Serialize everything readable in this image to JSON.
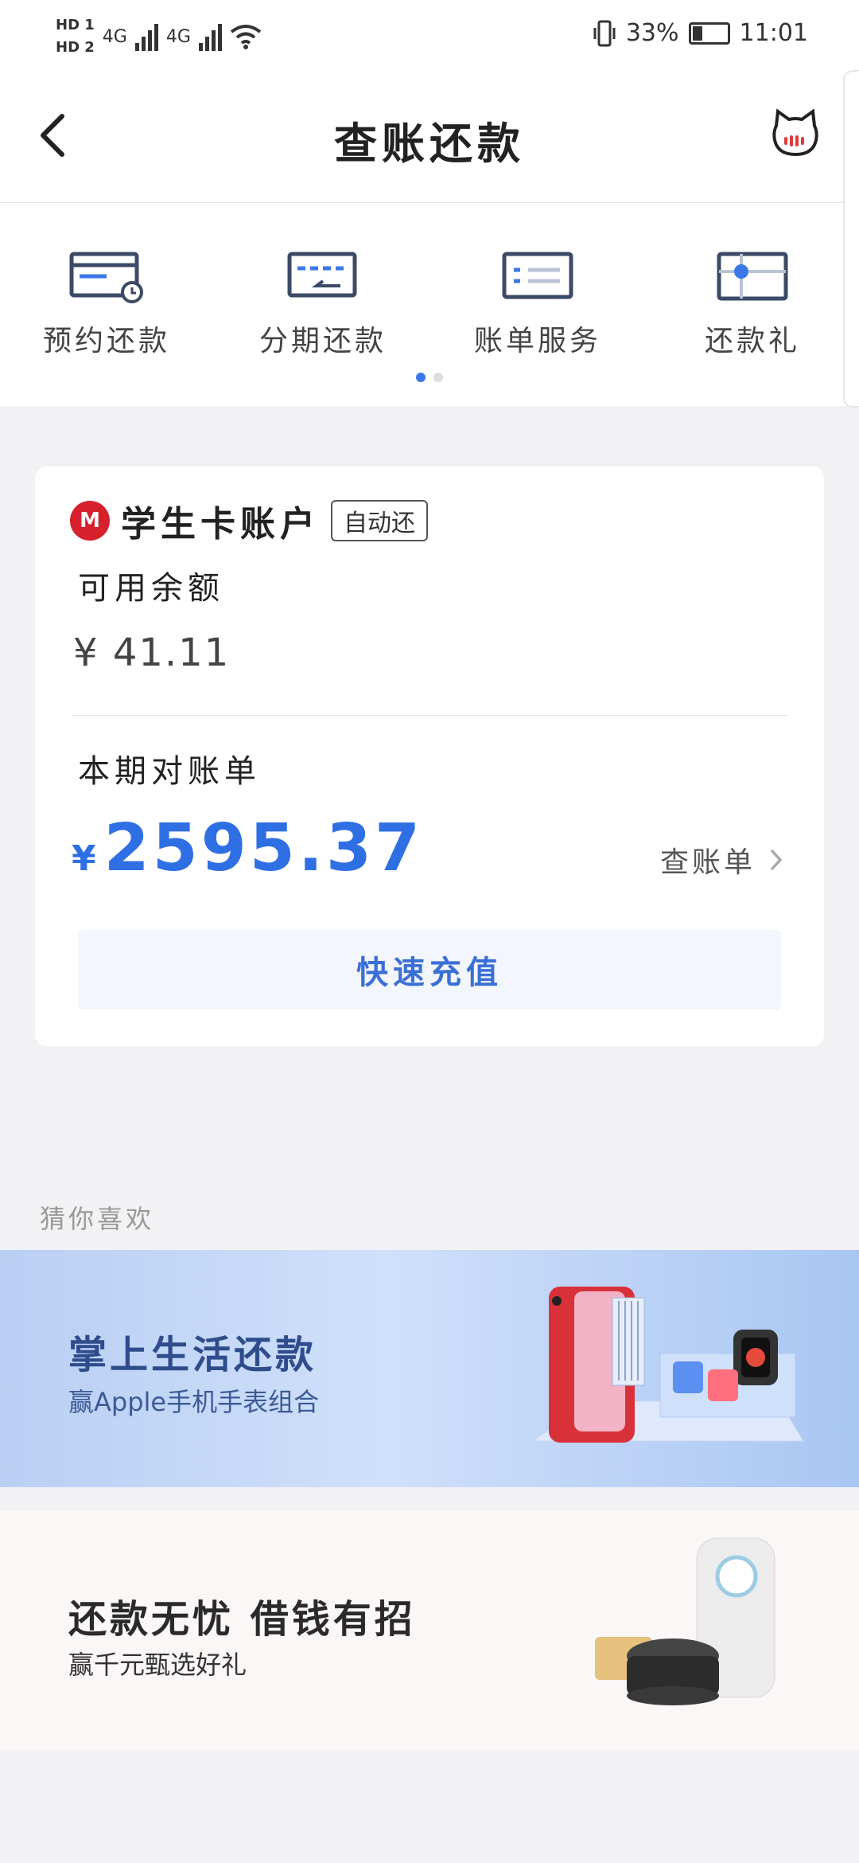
{
  "status_bar": {
    "sim1": "HD 1",
    "sim2": "HD 2",
    "network1": "4G",
    "network2": "4G",
    "battery": "33%",
    "time": "11:01"
  },
  "nav": {
    "title": "查账还款"
  },
  "quick_menu": {
    "items": [
      {
        "label": "预约还款",
        "icon": "scheduled-repay-icon"
      },
      {
        "label": "分期还款",
        "icon": "installment-icon"
      },
      {
        "label": "账单服务",
        "icon": "bill-service-icon"
      },
      {
        "label": "还款礼",
        "icon": "repay-gift-icon"
      }
    ],
    "page": 1,
    "pages": 2
  },
  "account": {
    "name": "学生卡账户",
    "tag": "自动还",
    "available_label": "可用余额",
    "available_currency": "¥",
    "available_amount": "41.11",
    "bill_label": "本期对账单",
    "bill_currency": "¥",
    "bill_amount": "2595.37",
    "view_bill": "查账单",
    "recharge_button": "快速充值"
  },
  "recommend": {
    "section_title": "猜你喜欢",
    "banner1": {
      "title": "掌上生活还款",
      "subtitle": "赢Apple手机手表组合"
    },
    "banner2": {
      "title": "还款无忧 借钱有招",
      "subtitle": "赢千元甄选好礼"
    }
  },
  "colors": {
    "accent": "#3a78e8",
    "brand_red": "#d6202c"
  }
}
